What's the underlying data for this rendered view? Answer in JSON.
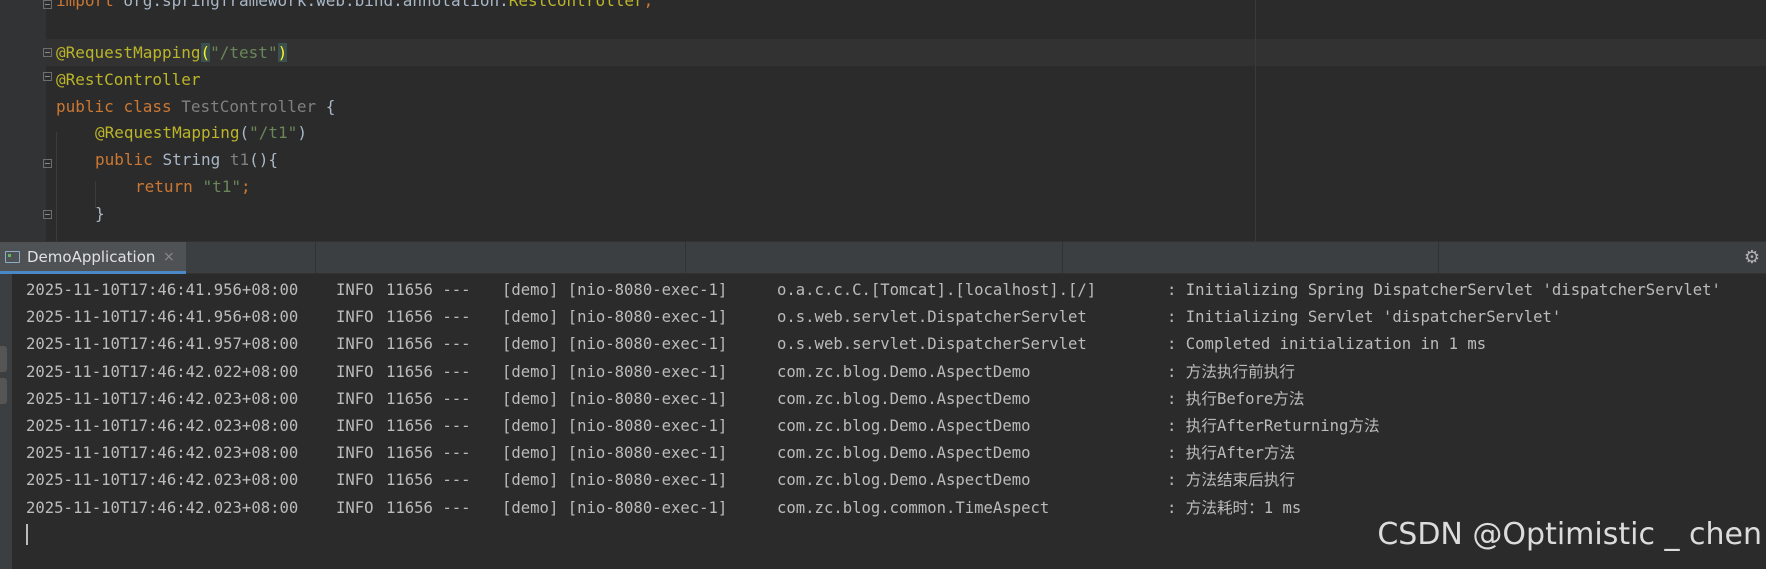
{
  "editor": {
    "line0": {
      "kw": "import",
      "rest": " org.springframework.web.bind.annotation.",
      "cls": "RestController",
      "end": ";"
    },
    "line1": {
      "ann": "@RequestMapping",
      "open": "(",
      "str": "\"/test\"",
      "close": ")"
    },
    "line2": {
      "ann": "@RestController"
    },
    "line3": {
      "kw1": "public",
      "kw2": "class",
      "cls": "TestController",
      "brace": "{"
    },
    "line4": {
      "ann": "@RequestMapping",
      "open": "(",
      "str": "\"/t1\"",
      "close": ")"
    },
    "line5": {
      "kw": "public",
      "type": "String",
      "fn": "t1",
      "rest": "(){"
    },
    "line6": {
      "kw": "return",
      "str": "\"t1\"",
      "end": ";"
    },
    "line7": {
      "brace": "}"
    }
  },
  "run_panel": {
    "tab_label": "DemoApplication",
    "tab_close": "×",
    "settings_icon": "gear-icon",
    "accent_color": "#4a88c7"
  },
  "console": {
    "lines": [
      {
        "ts": "2025-11-10T17:46:41.956+08:00",
        "level": "INFO",
        "pid": "11656 ---",
        "thread": "[demo] [nio-8080-exec-1]",
        "source": "o.a.c.c.C.[Tomcat].[localhost].[/]",
        "message": ": Initializing Spring DispatcherServlet 'dispatcherServlet'"
      },
      {
        "ts": "2025-11-10T17:46:41.956+08:00",
        "level": "INFO",
        "pid": "11656 ---",
        "thread": "[demo] [nio-8080-exec-1]",
        "source": "o.s.web.servlet.DispatcherServlet",
        "message": ": Initializing Servlet 'dispatcherServlet'"
      },
      {
        "ts": "2025-11-10T17:46:41.957+08:00",
        "level": "INFO",
        "pid": "11656 ---",
        "thread": "[demo] [nio-8080-exec-1]",
        "source": "o.s.web.servlet.DispatcherServlet",
        "message": ": Completed initialization in 1 ms"
      },
      {
        "ts": "2025-11-10T17:46:42.022+08:00",
        "level": "INFO",
        "pid": "11656 ---",
        "thread": "[demo] [nio-8080-exec-1]",
        "source": "com.zc.blog.Demo.AspectDemo",
        "message": ": 方法执行前执行"
      },
      {
        "ts": "2025-11-10T17:46:42.023+08:00",
        "level": "INFO",
        "pid": "11656 ---",
        "thread": "[demo] [nio-8080-exec-1]",
        "source": "com.zc.blog.Demo.AspectDemo",
        "message": ": 执行Before方法"
      },
      {
        "ts": "2025-11-10T17:46:42.023+08:00",
        "level": "INFO",
        "pid": "11656 ---",
        "thread": "[demo] [nio-8080-exec-1]",
        "source": "com.zc.blog.Demo.AspectDemo",
        "message": ": 执行AfterReturning方法"
      },
      {
        "ts": "2025-11-10T17:46:42.023+08:00",
        "level": "INFO",
        "pid": "11656 ---",
        "thread": "[demo] [nio-8080-exec-1]",
        "source": "com.zc.blog.Demo.AspectDemo",
        "message": ": 执行After方法"
      },
      {
        "ts": "2025-11-10T17:46:42.023+08:00",
        "level": "INFO",
        "pid": "11656 ---",
        "thread": "[demo] [nio-8080-exec-1]",
        "source": "com.zc.blog.Demo.AspectDemo",
        "message": ": 方法结束后执行"
      },
      {
        "ts": "2025-11-10T17:46:42.023+08:00",
        "level": "INFO",
        "pid": "11656 ---",
        "thread": "[demo] [nio-8080-exec-1]",
        "source": "com.zc.blog.common.TimeAspect",
        "message": ": 方法耗时：1 ms"
      }
    ]
  },
  "watermark": "CSDN @Optimistic _ chen"
}
